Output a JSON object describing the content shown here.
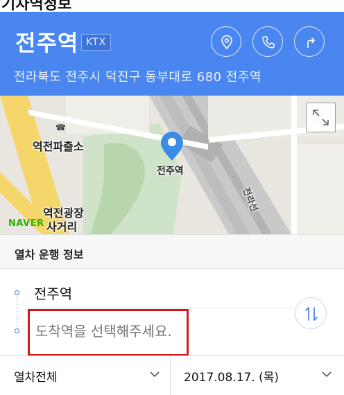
{
  "header": {
    "station_name": "전주역",
    "badge": "KTX",
    "address": "전라북도 전주시 덕진구 동부대로 680 전주역",
    "bg_color": "#4a86f0"
  },
  "actions": [
    {
      "icon": "location-pin-icon"
    },
    {
      "icon": "phone-icon"
    },
    {
      "icon": "directions-icon"
    }
  ],
  "map": {
    "labels": {
      "police": "역전파출소",
      "station": "전주역",
      "square": "역전광장",
      "crossroad": "사거리",
      "line": "전라선"
    },
    "provider": "NAVER"
  },
  "section": {
    "title": "열차 운행 정보"
  },
  "route": {
    "departure": "전주역",
    "arrival_placeholder": "도착역을 선택해주세요."
  },
  "filters": {
    "train_type": "열차전체",
    "date": "2017.08.17. (목)"
  }
}
